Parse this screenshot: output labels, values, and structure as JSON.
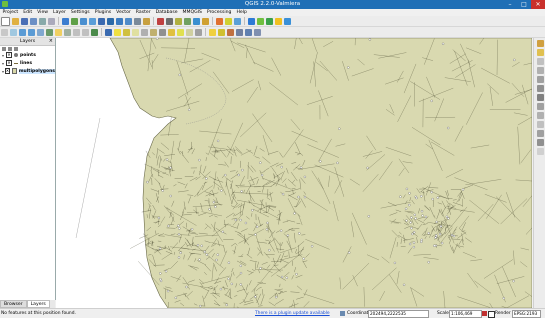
{
  "window": {
    "title": "QGIS 2.2.0-Valmiera"
  },
  "menu": [
    "Project",
    "Edit",
    "View",
    "Layer",
    "Settings",
    "Plugins",
    "Vector",
    "Raster",
    "Database",
    "MMQGIS",
    "Processing",
    "Help"
  ],
  "layers_panel": {
    "title": "Layers",
    "layers": [
      {
        "name": "points",
        "type": "point",
        "checked": true,
        "expanded": true
      },
      {
        "name": "lines",
        "type": "line",
        "checked": true,
        "expanded": true
      },
      {
        "name": "multipolygons",
        "type": "polygon",
        "checked": true,
        "expanded": true
      }
    ],
    "tabs": [
      "Browser",
      "Layers"
    ],
    "active_tab": "Layers"
  },
  "statusbar": {
    "message": "No features at this position found.",
    "update_link": "There is a plugin update available",
    "coordinate_label": "Coordinate:",
    "coordinate_value": "202494,2222535",
    "scale_label": "Scale",
    "scale_value": "1:106,469",
    "render_label": "Render",
    "crs": "EPSG:2193"
  },
  "colors": {
    "titlebar": "#1f6fb6",
    "land_fill": "#d9d9b0",
    "road_line": "#3a3a22",
    "sea": "#ffffff"
  },
  "icons": [
    "qgis-logo-icon",
    "minimize-icon",
    "maximize-icon",
    "close-icon"
  ]
}
